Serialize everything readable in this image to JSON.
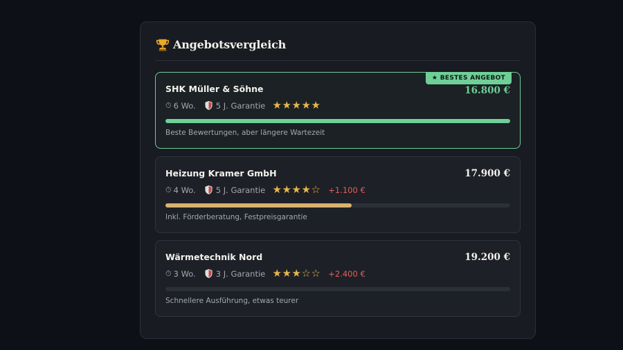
{
  "panel": {
    "title": "Angebotsvergleich",
    "title_icon": "trophy-icon"
  },
  "offers": [
    {
      "name": "SHK Müller & Söhne",
      "price": "16.800 €",
      "duration": "6 Wo.",
      "warranty": "5 J. Garantie",
      "rating": 5,
      "rating_max": 5,
      "delta": "",
      "score": 1.0,
      "bar_color": "#6fcf97",
      "note": "Beste Bewertungen, aber längere Wartezeit",
      "badge": "★ BESTES ANGEBOT",
      "best": true
    },
    {
      "name": "Heizung Kramer GmbH",
      "price": "17.900 €",
      "duration": "4 Wo.",
      "warranty": "5 J. Garantie",
      "rating": 4,
      "rating_max": 5,
      "delta": "+1.100 €",
      "score": 0.54,
      "bar_color": "#d9b26f",
      "note": "Inkl. Förderberatung, Festpreisgarantie",
      "badge": "",
      "best": false
    },
    {
      "name": "Wärmetechnik Nord",
      "price": "19.200 €",
      "duration": "3 Wo.",
      "warranty": "3 J. Garantie",
      "rating": 3,
      "rating_max": 5,
      "delta": "+2.400 €",
      "score": 0.0,
      "bar_color": "#d9b26f",
      "note": "Schnellere Ausführung, etwas teurer",
      "badge": "",
      "best": false
    }
  ],
  "colors": {
    "accent_green": "#6fcf97",
    "star": "#e8b64c",
    "delta_red": "#e0605a"
  }
}
